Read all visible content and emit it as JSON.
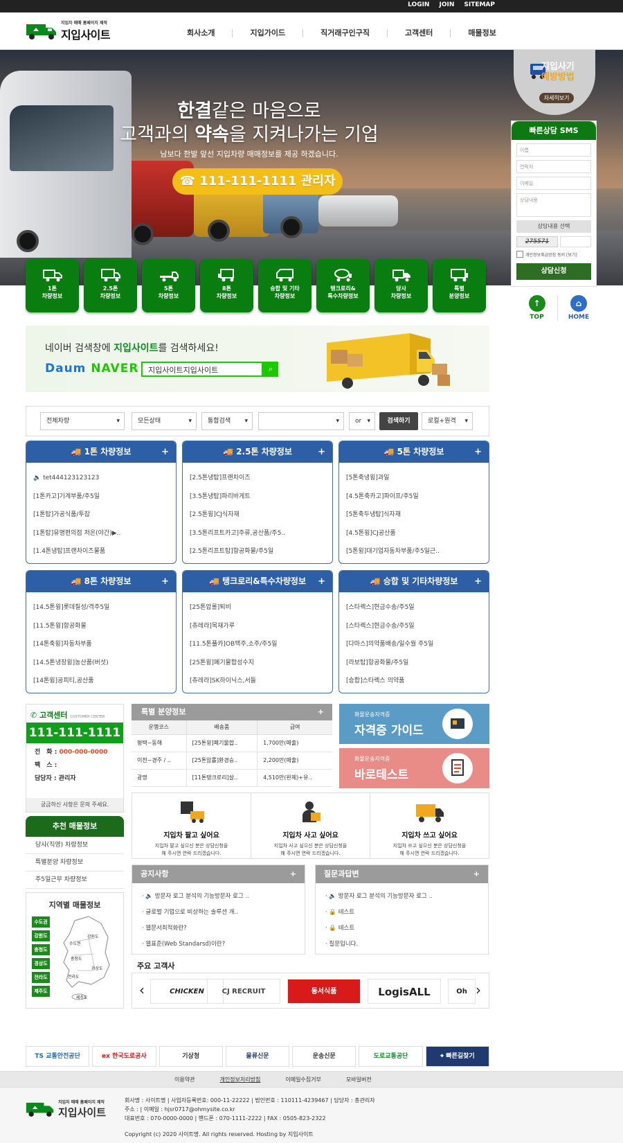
{
  "util": {
    "login": "LOGIN",
    "join": "JOIN",
    "sitemap": "SITEMAP"
  },
  "logo": {
    "sub": "지입차 매매 홈페이지 제작",
    "main": "지입사이트"
  },
  "gnb": [
    "회사소개",
    "지입가이드",
    "직거래구인구직",
    "고객센터",
    "매물정보"
  ],
  "hero": {
    "line1_bold": "한결",
    "line1": "같은 마음으로",
    "line2_pre": "고객과의 ",
    "line2_bold": "약속",
    "line2_post": "을 지켜나가는 기업",
    "desc": "남보다 한발 앞선 지입차량 매매정보를 제공 하겠습니다.",
    "call": "☎ 111-111-1111 관리자"
  },
  "categories": [
    {
      "l1": "1톤",
      "l2": "차량정보"
    },
    {
      "l1": "2.5톤",
      "l2": "차량정보"
    },
    {
      "l1": "5톤",
      "l2": "차량정보"
    },
    {
      "l1": "8톤",
      "l2": "차량정보"
    },
    {
      "l1": "승합 및 기타",
      "l2": "차량정보"
    },
    {
      "l1": "탱크로리&",
      "l2": "특수차량정보"
    },
    {
      "l1": "당사",
      "l2": "차량정보"
    },
    {
      "l1": "특별",
      "l2": "분양정보"
    }
  ],
  "quick": {
    "t1": "지입사기",
    "t2": "예방방법",
    "more": "자세히보기"
  },
  "sms": {
    "title": "빠른상담 SMS",
    "name_ph": "이름",
    "phone_ph": "연락처",
    "email_ph": "이메일",
    "content_ph": "상담내용",
    "select": "상담내용 선택",
    "captcha": "275571",
    "agree": "개인정보취급방침 동의 [보기]",
    "submit": "상담신청"
  },
  "side": {
    "top": "TOP",
    "home": "HOME"
  },
  "naver": {
    "text_pre": "네이버 검색창에 ",
    "text_bold": "지입사이트",
    "text_post": "를 검색하세요!",
    "daum": "Daum",
    "naver": "NAVER",
    "query": "지입사이트지입사이트"
  },
  "search": {
    "s1": "전체차량",
    "s2": "모든상태",
    "s3": "통합검색",
    "s4": "or",
    "btn": "검색하기",
    "s5": "로컬+원격"
  },
  "boxes": [
    {
      "title": "🚚 1톤 차량정보",
      "items": [
        "🔈 tet444123123123",
        "[1톤카고]기계부품/주5일",
        "[1톤탑]가공식품/투잡",
        "[1톤탑]유명편의점 저온(야간)▶..",
        "[1.4톤냉탑]프랜차이즈물품"
      ]
    },
    {
      "title": "🚚 2.5톤 차량정보",
      "items": [
        "[2.5톤냉탑]프랜차이즈",
        "[3.5톤냉탑]파리바게트",
        "[2.5톤윙]CJ식자재",
        "[3.5톤리프트카고]주류,공산품/주5..",
        "[2.5톤리프트탑]항공화물/주5일"
      ]
    },
    {
      "title": "🚚 5톤 차량정보",
      "items": [
        "[5톤축냉윙]과일",
        "[4.5톤축카고]파이프/주5일",
        "[5톤축두냉탑]식자재",
        "[4.5톤윙]CJ공산품",
        "[5톤윙]대기업자동차부품/주5일근.."
      ]
    },
    {
      "title": "🚚 8톤 차량정보",
      "items": [
        "[14.5톤윙]롯데칠성/격주5일",
        "[11.5톤윙]항공화물",
        "[14톤축윙]자동차부품",
        "[14.5톤냉장윙]농산품(버섯)",
        "[14톤윙]공피티,공산품"
      ]
    },
    {
      "title": "🚚 탱크로리&특수차량정보",
      "items": [
        "[25톤압롤]퇴비",
        "[츄레라]목재가루",
        "[11.5톤풀카]OB맥주,소주/주5일",
        "[25톤윙]폐기물합성수지",
        "[츄레라]SK하이닉스,서들"
      ]
    },
    {
      "title": "🚚 승합 및 기타차량정보",
      "items": [
        "[스타렉스]현금수송/주5일",
        "[스타렉스]현금수송/주5일",
        "[다마스]의약품배송/일수월 주5일",
        "[라보탑]항공화물/주5일",
        "[승합]스타렉스 의약품"
      ]
    }
  ],
  "cc": {
    "title": "고객센터",
    "title_en": "CUSTOMER CENTER",
    "phone": "111-111-1111",
    "tel_l": "전　화 : ",
    "tel_v": "000-000-0000",
    "fax_l": "팩　스 :",
    "mgr_l": "담당자 : ",
    "mgr_v": "관리자",
    "note": "궁금하신 사항은 문의 주세요."
  },
  "rec": {
    "title": "추천 매물정보",
    "items": [
      "당사(직영) 차량정보",
      "특별분양 차량정보",
      "주5일근무 차량정보"
    ]
  },
  "region": {
    "title": "지역별 매물정보",
    "tags": [
      "수도권",
      "강원도",
      "충청도",
      "경상도",
      "전라도",
      "제주도"
    ],
    "map_labels": [
      "강원도",
      "수도권",
      "충청도",
      "경상도",
      "전라도",
      "제주도"
    ]
  },
  "special": {
    "title": "특별 분양정보",
    "cols": [
      "운행코스",
      "배송품",
      "급여"
    ],
    "rows": [
      [
        "평택~동해",
        "[25톤윙]폐기물합..",
        "1,700만(매출)"
      ],
      [
        "이천~경주 / ..",
        "[25톤압롤]환경승..",
        "2,200만(매출)"
      ],
      [
        "광명",
        "[11톤탱크로리]살..",
        "4,510만(완제)+유.."
      ]
    ]
  },
  "lic1": {
    "small": "화물운송자격증",
    "big": "자격증 가이드"
  },
  "lic2": {
    "small": "화물운송자격증",
    "big": "바로테스트"
  },
  "sbu": [
    {
      "t": "지입차 팔고 싶어요",
      "d1": "지입차 팔고 싶으신 분은 상담신청을",
      "d2": "해 주시면 연락 드리겠습니다."
    },
    {
      "t": "지입차 사고 싶어요",
      "d1": "지입차 사고 싶으신 분은 상담신청을",
      "d2": "해 주시면 연락 드리겠습니다."
    },
    {
      "t": "지입차 쓰고 싶어요",
      "d1": "지입차 쓰고 싶으신 분은 상담신청을",
      "d2": "해 주시면 연락 드리겠습니다."
    }
  ],
  "notice": {
    "title": "공지사항",
    "items": [
      "· 🔈 방문자 로그 분석의 기능방문자 로그 ..",
      "· 글로벌 기업으로 비상하는 솔루션 개..",
      "· 웹문서최적화란?",
      "· 웹표준(Web Standarsd)이란?"
    ]
  },
  "qna": {
    "title": "질문과답변",
    "items": [
      "· 🔈 방문자 로그 분석의 기능방문자 로그 ..",
      "· 🔒 테스트",
      "· 🔒 테스트",
      "· 질문입니다."
    ]
  },
  "clients": {
    "title": "주요 고객사",
    "logos": [
      "CHICKEN",
      "CJ RECRUIT",
      "동서식품",
      "LogisALL",
      "Oh"
    ]
  },
  "partners": [
    "TS 교통안전공단",
    "ex 한국도로공사",
    "기상청",
    "물류신문",
    "운송신문",
    "도로교통공단",
    "빠른길찾기"
  ],
  "fnav": [
    "이용약관",
    "개인정보처리방침",
    "이메일수집거부",
    "모바일버전"
  ],
  "footer": {
    "l1": "회사명 : 사이트명 | 사업자등록번호: 000-11-22222 | 법인번호 : 110111-4239467 | 담당자 : 총관리자",
    "l2": "주소 : | 이메일 : hjsr0717@ohmysite.co.kr",
    "l3": "대표번호 : 070-0000-0000 | 핸드폰 : 070-1111-2222 | FAX : 0505-823-2322",
    "copy": "Copyright (c) 2020 사이트명. All rights reserved. Hosting by 지입사이트"
  },
  "colors": {
    "green": "#0a7d10",
    "blue": "#2d5fa6",
    "yellow": "#f2be17"
  }
}
